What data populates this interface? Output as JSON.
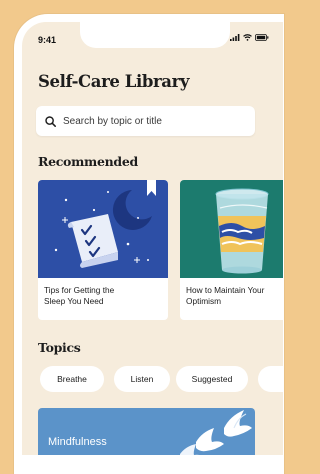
{
  "status_bar": {
    "time": "9:41"
  },
  "page_title": "Self-Care Library",
  "search": {
    "placeholder": "Search by topic or title"
  },
  "recommended": {
    "heading": "Recommended",
    "cards": [
      {
        "title": "Tips for Getting the\nSleep You Need",
        "icon": "sleep-illustration"
      },
      {
        "title": "How to Maintain Your\nOptimism",
        "icon": "glass-illustration"
      }
    ]
  },
  "topics": {
    "heading": "Topics",
    "chips": [
      "Breathe",
      "Listen",
      "Suggested"
    ]
  },
  "feature_banner": {
    "label": "Mindfulness",
    "icon": "doves-illustration"
  },
  "colors": {
    "background": "#f2c98c",
    "screen": "#f6ecdc",
    "sleep_card": "#2d4fa6",
    "optimism_card": "#1c7b6e",
    "mindfulness_banner": "#5b93c9"
  }
}
